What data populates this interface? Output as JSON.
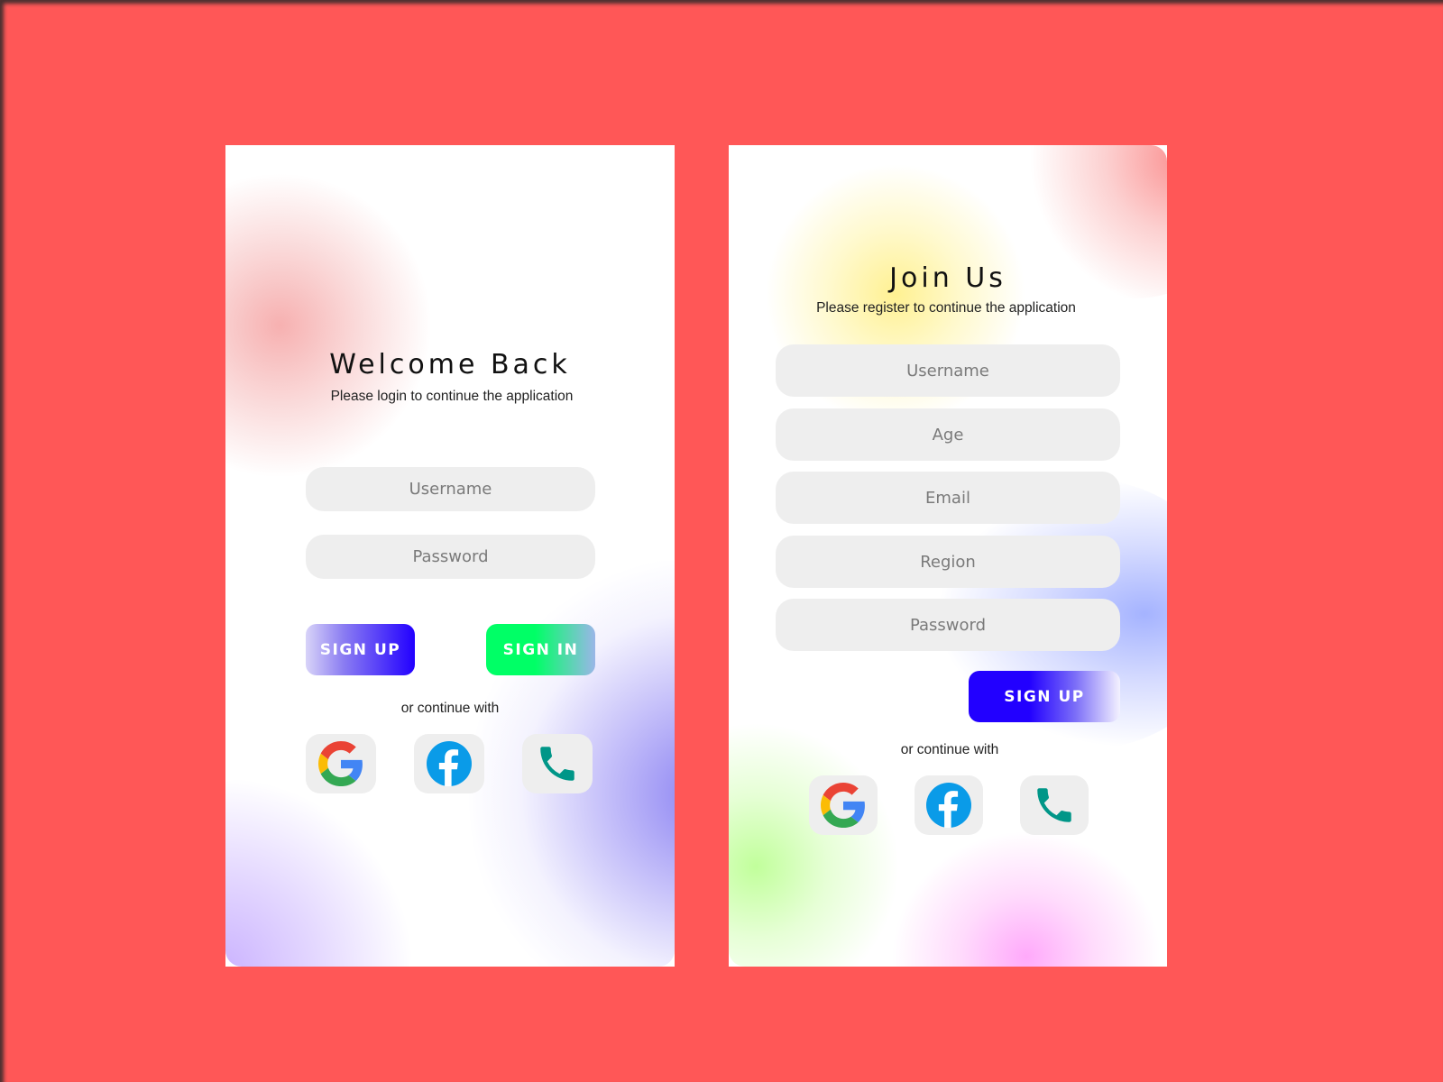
{
  "login": {
    "title": "Welcome Back",
    "subtitle": "Please login to continue the application",
    "fields": [
      {
        "placeholder": "Username",
        "value": ""
      },
      {
        "placeholder": "Password",
        "value": ""
      }
    ],
    "signup_label": "SIGN UP",
    "signin_label": "SIGN IN",
    "continue_text": "or continue with",
    "social": [
      {
        "icon": "google-icon",
        "label": "Google"
      },
      {
        "icon": "facebook-icon",
        "label": "Facebook"
      },
      {
        "icon": "phone-icon",
        "label": "Phone"
      }
    ]
  },
  "register": {
    "title": "Join Us",
    "subtitle": "Please register to continue the application",
    "fields": [
      {
        "placeholder": "Username",
        "value": ""
      },
      {
        "placeholder": "Age",
        "value": ""
      },
      {
        "placeholder": "Email",
        "value": ""
      },
      {
        "placeholder": "Region",
        "value": ""
      },
      {
        "placeholder": "Password",
        "value": ""
      }
    ],
    "signup_label": "SIGN UP",
    "continue_text": "or continue with",
    "social": [
      {
        "icon": "google-icon",
        "label": "Google"
      },
      {
        "icon": "facebook-icon",
        "label": "Facebook"
      },
      {
        "icon": "phone-icon",
        "label": "Phone"
      }
    ]
  },
  "colors": {
    "background": "#ff5757",
    "field_bg": "#eeeeee",
    "signup_blue": "#2200ff",
    "signin_green": "#00ff66",
    "facebook_blue": "#0a9be8",
    "phone_teal": "#009688"
  }
}
